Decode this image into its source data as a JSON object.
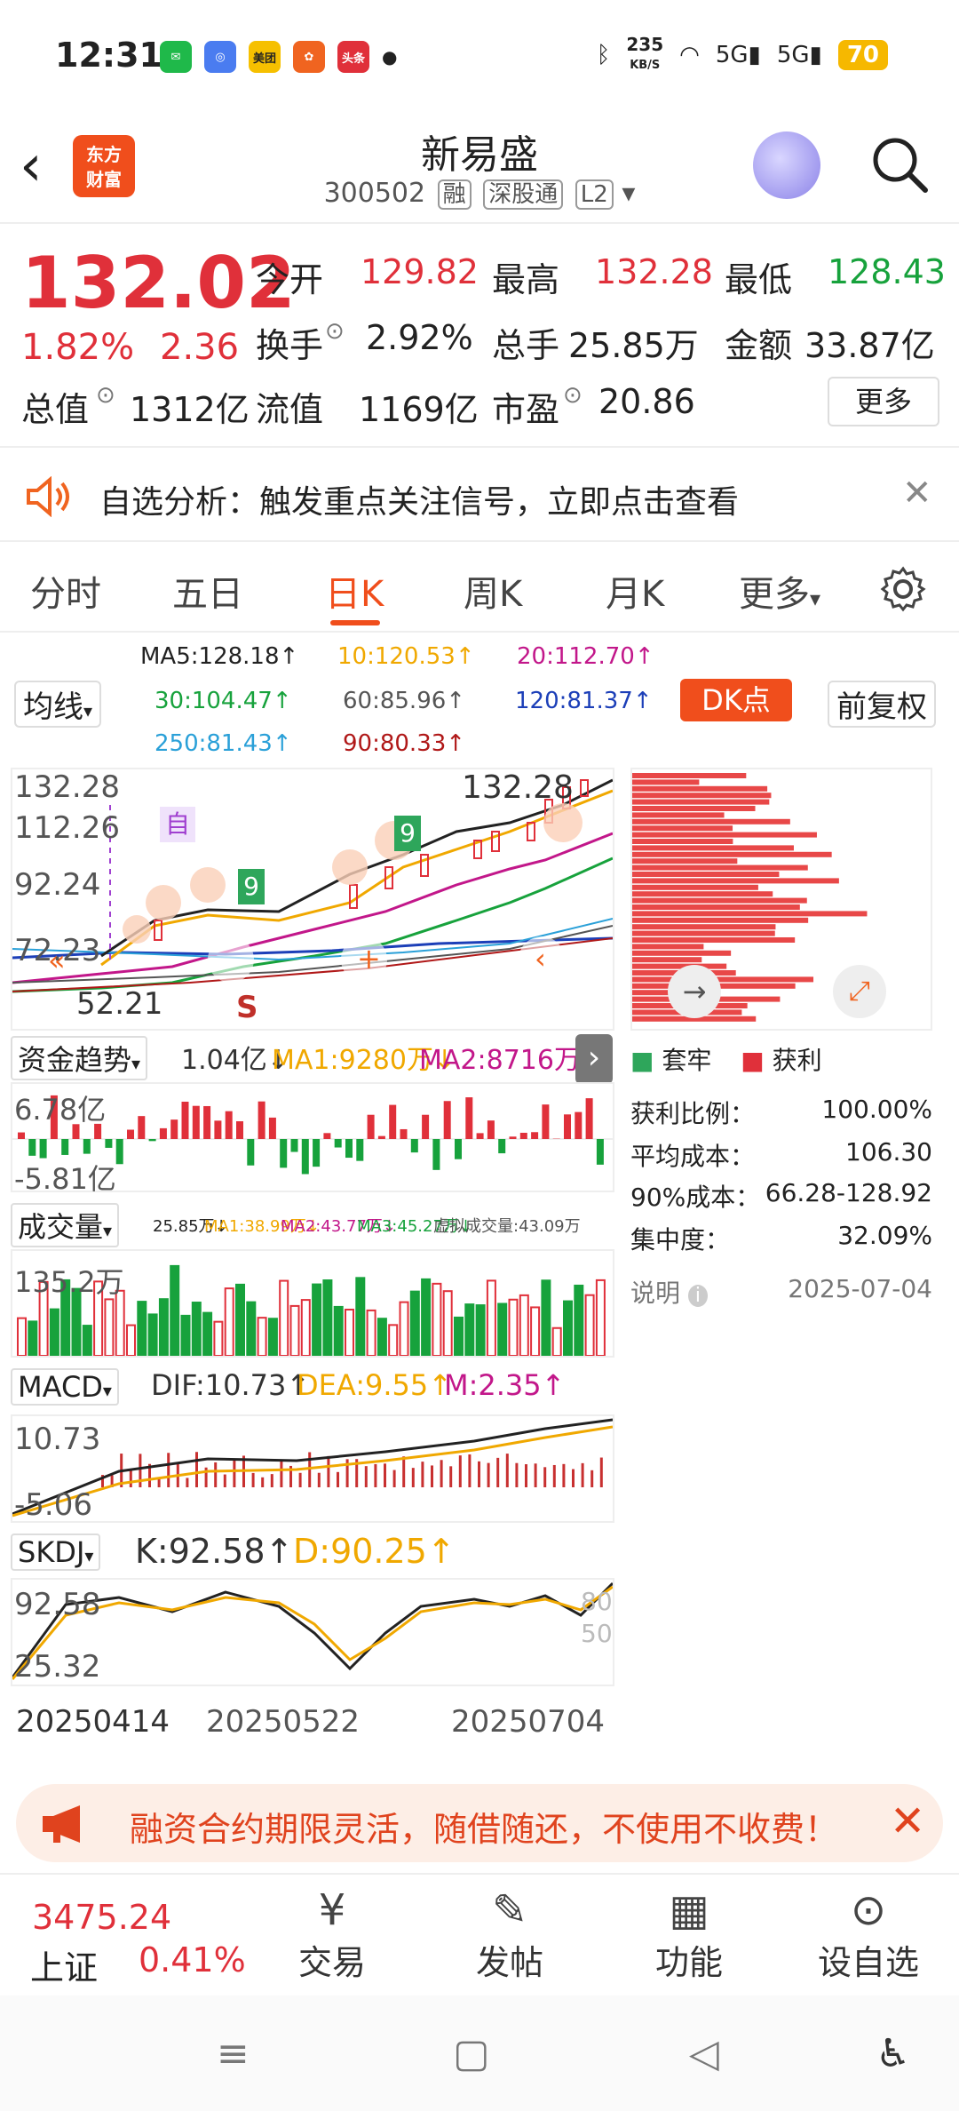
{
  "status": {
    "time": "12:31",
    "net_speed": "235",
    "net_unit": "KB/S",
    "battery": "70",
    "app_mini": [
      "美团",
      "头条"
    ]
  },
  "header": {
    "stock_name": "新易盛",
    "code": "300502",
    "tags": [
      "融",
      "深股通",
      "L2"
    ],
    "logo_line1": "东方",
    "logo_line2": "财富"
  },
  "quote": {
    "price": "132.02",
    "change_pct": "1.82%",
    "change": "2.36",
    "fields": [
      {
        "label": "今开",
        "value": "129.82"
      },
      {
        "label": "最高",
        "value": "132.28"
      },
      {
        "label": "最低",
        "value": "128.43"
      },
      {
        "label": "换手",
        "value": "2.92%"
      },
      {
        "label": "总手",
        "value": "25.85万"
      },
      {
        "label": "金额",
        "value": "33.87亿"
      },
      {
        "label": "总值",
        "value": "1312亿"
      },
      {
        "label": "流值",
        "value": "1169亿"
      },
      {
        "label": "市盈",
        "value": "20.86"
      }
    ],
    "more": "更多"
  },
  "notice": {
    "text": "自选分析：触发重点关注信号，立即点击查看"
  },
  "tabs": [
    "分时",
    "五日",
    "日K",
    "周K",
    "月K",
    "更多"
  ],
  "ma": {
    "selector": "均线",
    "items": [
      "MA5:128.18↑",
      "10:120.53↑",
      "20:112.70↑",
      "30:104.47↑",
      "60:85.96↑",
      "120:81.37↑",
      "250:81.43↑",
      "90:80.33↑"
    ],
    "dk": "DK点",
    "adjust": "前复权"
  },
  "kline": {
    "ticks": [
      "132.28",
      "112.26",
      "92.24",
      "72.23",
      "52.21"
    ],
    "high_mark": "132.28",
    "low_mark": "52.21",
    "markers": [
      "自",
      "S"
    ],
    "seq_labels": [
      "9",
      "9"
    ]
  },
  "chips": {
    "legend": [
      "套牢",
      "获利"
    ],
    "stats": [
      {
        "label": "获利比例：",
        "value": "100.00%"
      },
      {
        "label": "平均成本：",
        "value": "106.30"
      },
      {
        "label": "90%成本：",
        "value": "66.28-128.92"
      },
      {
        "label": "集中度：",
        "value": "32.09%"
      }
    ],
    "note": "说明",
    "date": "2025-07-04"
  },
  "fund": {
    "selector": "资金趋势",
    "v": "1.04亿↓",
    "ma1": "MA1:9280万↓",
    "ma2": "MA2:8716万↑",
    "top": "6.78亿",
    "bottom": "-5.81亿"
  },
  "volume": {
    "selector": "成交量",
    "v": "25.85万↓",
    "ma1": "MA1:38.99万↓",
    "ma2": "MA2:43.77万↓",
    "ma3": "MA3:45.27万↓",
    "virt": "虚拟成交量:43.09万",
    "top": "135.2万"
  },
  "macd": {
    "selector": "MACD",
    "dif": "DIF:10.73↑",
    "dea": "DEA:9.55↑",
    "m": "M:2.35↑",
    "top": "10.73",
    "bottom": "-5.06"
  },
  "skdj": {
    "selector": "SKDJ",
    "k": "K:92.58↑",
    "d": "D:90.25↑",
    "top": "92.58",
    "bottom": "25.32",
    "l80": "80",
    "l50": "50"
  },
  "dates": [
    "20250414",
    "20250522",
    "20250704"
  ],
  "ad": {
    "text": "融资合约期限灵活，随借随还，不使用不收费！"
  },
  "bottom_nav": {
    "index_value": "3475.24",
    "index_name": "上证",
    "index_pct": "0.41%",
    "items": [
      "交易",
      "发帖",
      "功能",
      "设自选"
    ]
  }
}
